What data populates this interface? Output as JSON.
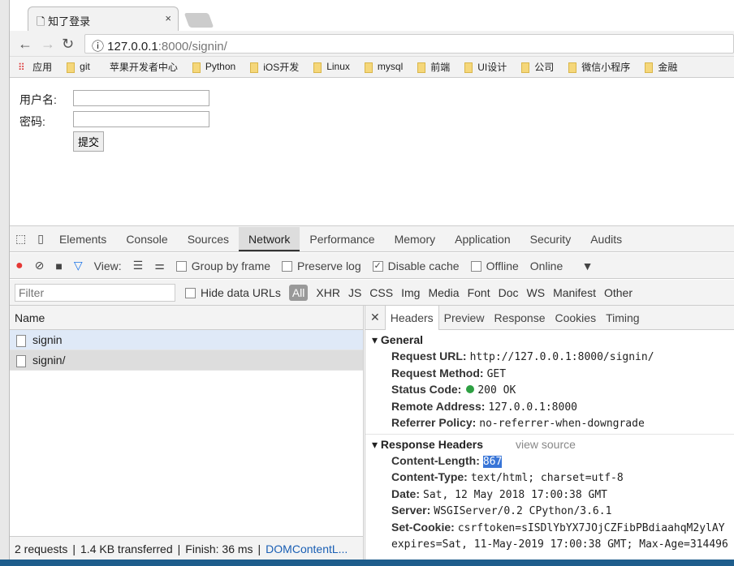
{
  "browser": {
    "tab_title": "知了登录",
    "tab_close": "×",
    "url_host": "127.0.0.1",
    "url_rest": ":8000/signin/",
    "bookmarks": [
      {
        "label": "应用",
        "icon": "apps-icon"
      },
      {
        "label": "git",
        "icon": "folder-icon"
      },
      {
        "label": "苹果开发者中心",
        "icon": "apple-icon"
      },
      {
        "label": "Python",
        "icon": "folder-icon"
      },
      {
        "label": "iOS开发",
        "icon": "folder-icon"
      },
      {
        "label": "Linux",
        "icon": "folder-icon"
      },
      {
        "label": "mysql",
        "icon": "folder-icon"
      },
      {
        "label": "前端",
        "icon": "folder-icon"
      },
      {
        "label": "UI设计",
        "icon": "folder-icon"
      },
      {
        "label": "公司",
        "icon": "folder-icon"
      },
      {
        "label": "微信小程序",
        "icon": "folder-icon"
      },
      {
        "label": "金融",
        "icon": "folder-icon"
      }
    ]
  },
  "form": {
    "username_label": "用户名:",
    "password_label": "密码:",
    "username_value": "",
    "password_value": "",
    "submit": "提交"
  },
  "devtools": {
    "tabs": [
      "Elements",
      "Console",
      "Sources",
      "Network",
      "Performance",
      "Memory",
      "Application",
      "Security",
      "Audits"
    ],
    "active_tab": "Network",
    "toolbar": {
      "view": "View:",
      "group_by_frame": "Group by frame",
      "preserve_log": "Preserve log",
      "disable_cache": "Disable cache",
      "offline": "Offline",
      "throttle": "Online"
    },
    "filter": {
      "placeholder": "Filter",
      "hide_data_urls": "Hide data URLs",
      "types": [
        "All",
        "XHR",
        "JS",
        "CSS",
        "Img",
        "Media",
        "Font",
        "Doc",
        "WS",
        "Manifest",
        "Other"
      ]
    },
    "name_header": "Name",
    "requests": [
      "signin",
      "signin/"
    ],
    "detail_tabs": [
      "Headers",
      "Preview",
      "Response",
      "Cookies",
      "Timing"
    ],
    "general": {
      "title": "General",
      "rows": [
        {
          "k": "Request URL:",
          "v": "http://127.0.0.1:8000/signin/"
        },
        {
          "k": "Request Method:",
          "v": "GET"
        },
        {
          "k": "Status Code:",
          "v": "200 OK"
        },
        {
          "k": "Remote Address:",
          "v": "127.0.0.1:8000"
        },
        {
          "k": "Referrer Policy:",
          "v": "no-referrer-when-downgrade"
        }
      ]
    },
    "response": {
      "title": "Response Headers",
      "view_source": "view source",
      "rows": [
        {
          "k": "Content-Length:",
          "v": "867"
        },
        {
          "k": "Content-Type:",
          "v": "text/html; charset=utf-8"
        },
        {
          "k": "Date:",
          "v": "Sat, 12 May 2018 17:00:38 GMT"
        },
        {
          "k": "Server:",
          "v": "WSGIServer/0.2 CPython/3.6.1"
        },
        {
          "k": "Set-Cookie:",
          "v": "csrftoken=sISDlYbYX7JOjCZFibPBdiaahqM2ylAY"
        }
      ],
      "continuation": "expires=Sat, 11-May-2019 17:00:38 GMT; Max-Age=314496"
    },
    "status": {
      "requests": "2 requests",
      "transferred": "1.4 KB transferred",
      "finish": "Finish: 36 ms",
      "dom": "DOMContentL..."
    },
    "colors": {
      "record": "#e53935",
      "filter": "#1a73e8",
      "status_ok": "#2ea043",
      "selection": "#3875d7"
    }
  }
}
